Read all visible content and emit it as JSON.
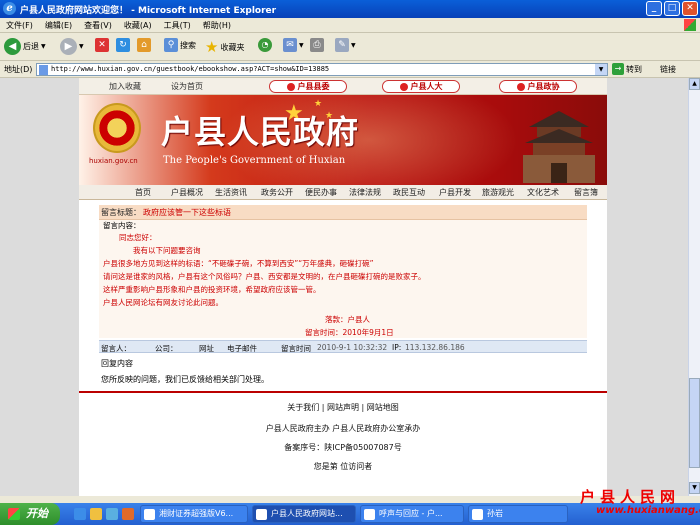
{
  "window": {
    "title": "户县人民政府网站欢迎您！ - Microsoft Internet Explorer"
  },
  "menubar": {
    "items": [
      "文件(F)",
      "编辑(E)",
      "查看(V)",
      "收藏(A)",
      "工具(T)",
      "帮助(H)"
    ]
  },
  "toolbar": {
    "back_label": "后退",
    "search_label": "搜索",
    "favorites_label": "收藏夹"
  },
  "addressbar": {
    "label": "地址(D)",
    "url": "http://www.huxian.gov.cn/guestbook/ebookshow.asp?ACT=show&ID=13885",
    "go_label": "转到",
    "links_label": "链接"
  },
  "site": {
    "topnav": {
      "add_favorite": "加入收藏",
      "set_homepage": "设为首页",
      "pills": [
        "户县县委",
        "户县人大",
        "户县政协"
      ]
    },
    "banner": {
      "title": "户县人民政府",
      "subtitle": "The People's Government of Huxian",
      "domain": "huxian.gov.cn"
    },
    "mainnav": [
      "首页",
      "户县概况",
      "生活资讯",
      "政务公开",
      "便民办事",
      "法律法规",
      "政民互动",
      "户县开发",
      "旅游观光",
      "文化艺术",
      "留言簿"
    ]
  },
  "message": {
    "title_label": "留言标题：",
    "title": "政府应该管一下这些标语",
    "content_label": "留言内容：",
    "greeting": "同志您好：",
    "intro": "我有以下问题要咨询",
    "body": [
      "户县很多地方见到这样的标语：“不砸碟子碗，不算到西安”“万年盛典，砸碟打碗”",
      "请问这是谁家的风格，户县有这个风俗吗？户县、西安都是文明的，在户县砸碟打碗的是败家子。",
      "这样严重影响户县形象和户县的投资环境，希望政府应该管一管。",
      "户县人民网论坛有网友讨论此问题。"
    ],
    "signature": "落款：户县人",
    "time_line": "留言时间：2010年9月1日"
  },
  "info": {
    "poster_label": "留言人：",
    "company_label": "公司：",
    "website_label": "网址",
    "email_label": "电子邮件",
    "time_label": "留言时间",
    "time_value": "2010-9-1 10:32:32",
    "ip_label": "IP:",
    "ip_value": "113.132.86.186"
  },
  "reply": {
    "label": "回复内容",
    "text": "您所反映的问题，我们已反馈给相关部门处理。"
  },
  "footer": {
    "links": [
      "关于我们",
      "网站声明",
      "网站地图"
    ],
    "sponsor": "户县人民政府主办 户县人民政府办公室承办",
    "icp": "备案序号：陕ICP备05007087号",
    "visitor": "您是第 位访问者"
  },
  "taskbar": {
    "start_label": "开始",
    "tasks": [
      "湘财证券超强版V6...",
      "户县人民政府网站...",
      "呼声与回应 - 户...",
      "孙岩"
    ]
  },
  "watermark": {
    "name": "户县人民网",
    "url": "www.huxianwang.c"
  }
}
